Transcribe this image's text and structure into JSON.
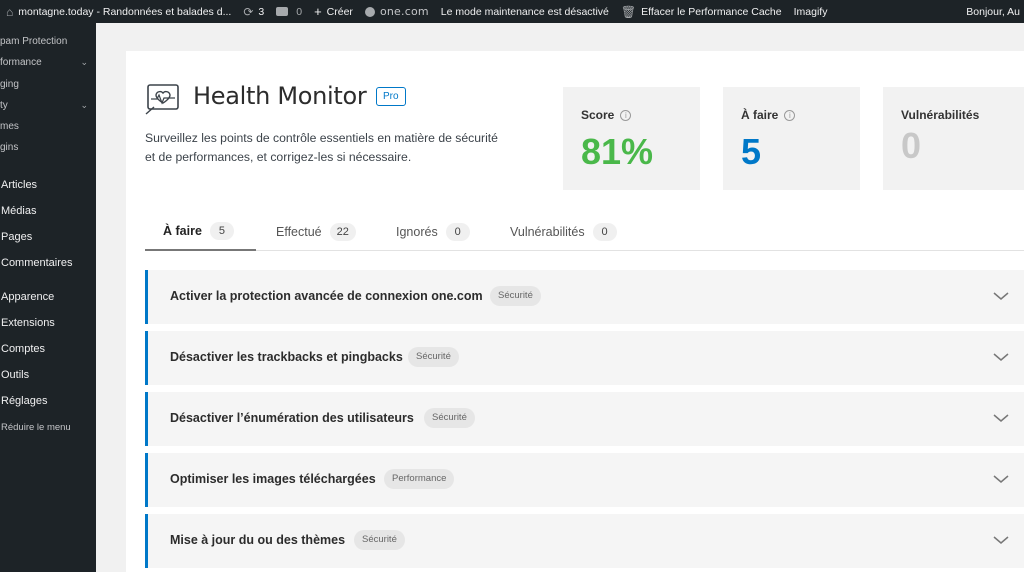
{
  "adminbar": {
    "site_name": "montagne.today - Randonnées et balades d...",
    "updates_count": "3",
    "comments_count": "0",
    "create_label": "Créer",
    "onecom_label": "one.com",
    "maintenance_label": "Le mode maintenance est désactivé",
    "clear_cache_label": "Effacer le Performance Cache",
    "imagify_label": "Imagify",
    "greeting": "Bonjour, Au"
  },
  "sidebar": {
    "sub_items": [
      {
        "label": "pam Protection"
      },
      {
        "label": "formance"
      },
      {
        "label": "ging"
      },
      {
        "label": "ty"
      },
      {
        "label": "mes"
      },
      {
        "label": "gins"
      }
    ],
    "main_items": [
      {
        "label": "Articles"
      },
      {
        "label": "Médias"
      },
      {
        "label": "Pages"
      },
      {
        "label": "Commentaires"
      },
      {
        "label": "Apparence"
      },
      {
        "label": "Extensions"
      },
      {
        "label": "Comptes"
      },
      {
        "label": "Outils"
      },
      {
        "label": "Réglages"
      }
    ],
    "collapse_label": "Réduire le menu"
  },
  "header": {
    "title": "Health Monitor",
    "pro_badge": "Pro",
    "description": "Surveillez les points de contrôle essentiels en matière de sécurité et de performances, et corrigez-les si nécessaire."
  },
  "stats": [
    {
      "label": "Score",
      "value": "81%",
      "color": "#4ab84a"
    },
    {
      "label": "À faire",
      "value": "5",
      "color": "#0078c8"
    },
    {
      "label": "Vulnérabilités",
      "value": "0",
      "color": "#c8c8c8"
    }
  ],
  "tabs": [
    {
      "label": "À faire",
      "count": "5"
    },
    {
      "label": "Effectué",
      "count": "22"
    },
    {
      "label": "Ignorés",
      "count": "0"
    },
    {
      "label": "Vulnérabilités",
      "count": "0"
    }
  ],
  "items": [
    {
      "title": "Activer la protection avancée de connexion one.com",
      "badge": "Sécurité"
    },
    {
      "title": "Désactiver les trackbacks et pingbacks",
      "badge": "Sécurité"
    },
    {
      "title": "Désactiver l’énumération des utilisateurs",
      "badge": "Sécurité"
    },
    {
      "title": "Optimiser les images téléchargées",
      "badge": "Performance"
    },
    {
      "title": "Mise à jour du ou des thèmes",
      "badge": "Sécurité"
    }
  ],
  "colors": {
    "accent": "#0078c8",
    "score_green": "#4ab84a",
    "admin_dark": "#1d2327"
  }
}
